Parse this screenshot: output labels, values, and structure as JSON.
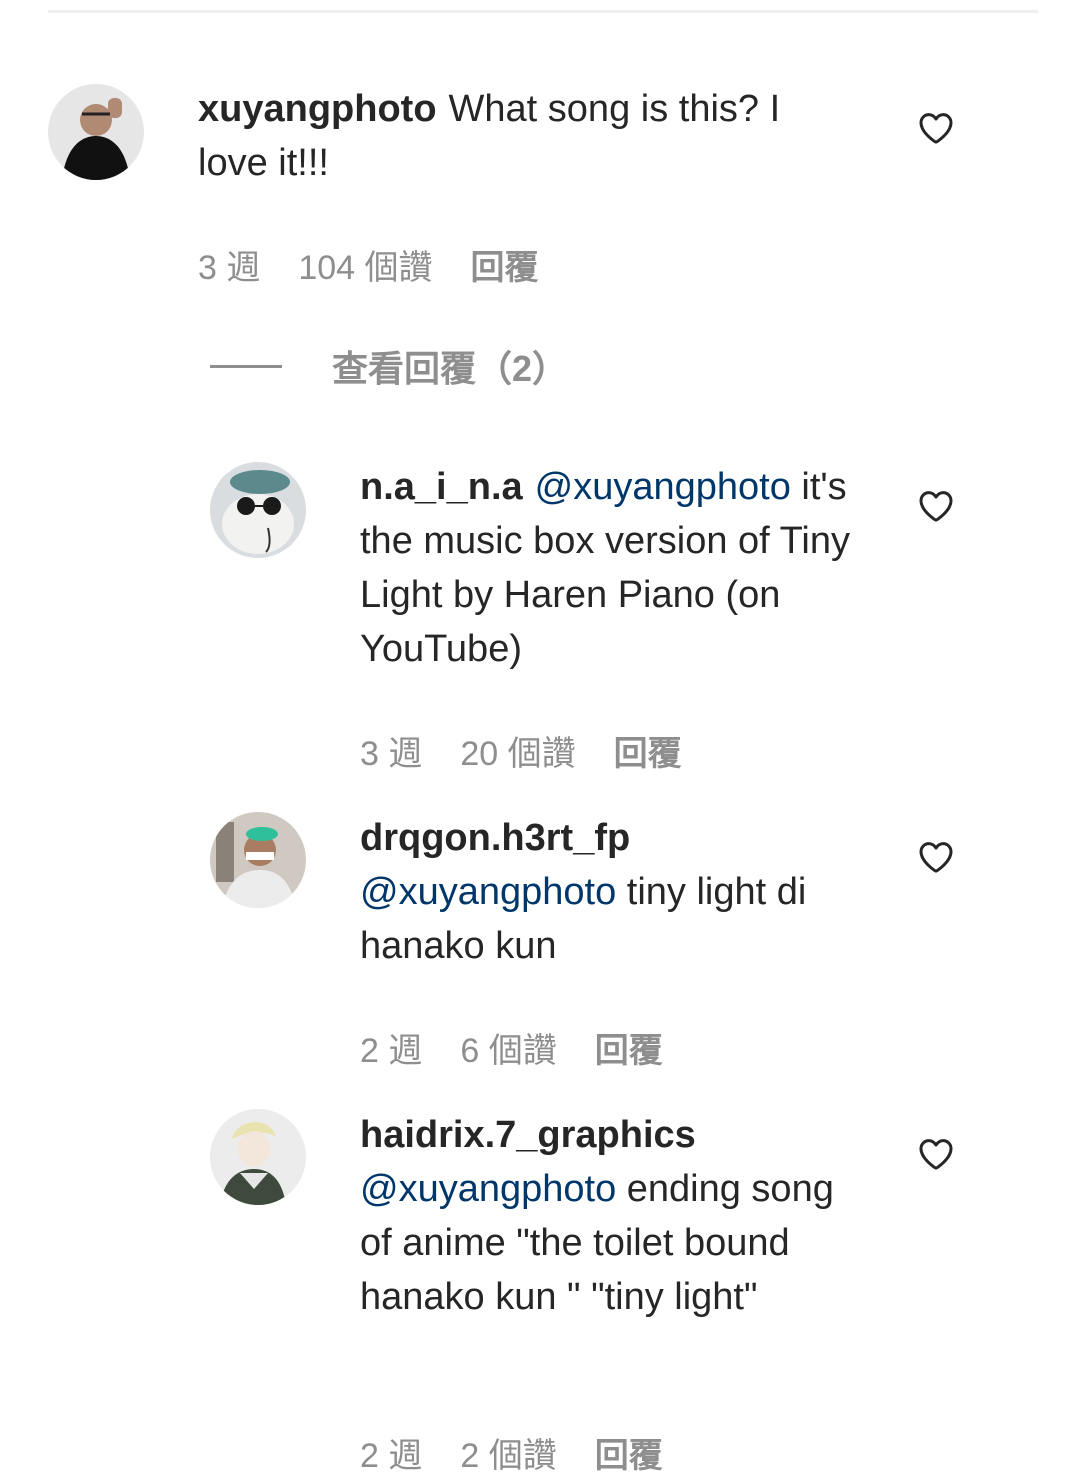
{
  "comments": [
    {
      "username": "xuyangphoto",
      "mention": "",
      "text": "What song is this? I love it!!!",
      "time": "3 週",
      "likes": "104 個讚",
      "reply": "回覆"
    }
  ],
  "view_replies": "查看回覆（2）",
  "replies": [
    {
      "username": "n.a_i_n.a",
      "mention": "@xuyangphoto",
      "text": "it's the music box version of Tiny Light by Haren Piano (on YouTube)",
      "time": "3 週",
      "likes": "20 個讚",
      "reply": "回覆"
    },
    {
      "username": "drqgon.h3rt_fp",
      "mention": "@xuyangphoto",
      "text": "tiny light di hanako kun",
      "time": "2 週",
      "likes": "6 個讚",
      "reply": "回覆"
    },
    {
      "username": "haidrix.7_graphics",
      "mention": "@xuyangphoto",
      "text": "ending song of anime \"the toilet bound hanako kun \" \"tiny light\"",
      "time": "2 週",
      "likes": "2 個讚",
      "reply": "回覆"
    }
  ],
  "icons": {
    "like": "heart-outline-icon"
  },
  "colors": {
    "text": "#262626",
    "secondary": "#8e8e8e",
    "mention": "#00376b"
  }
}
